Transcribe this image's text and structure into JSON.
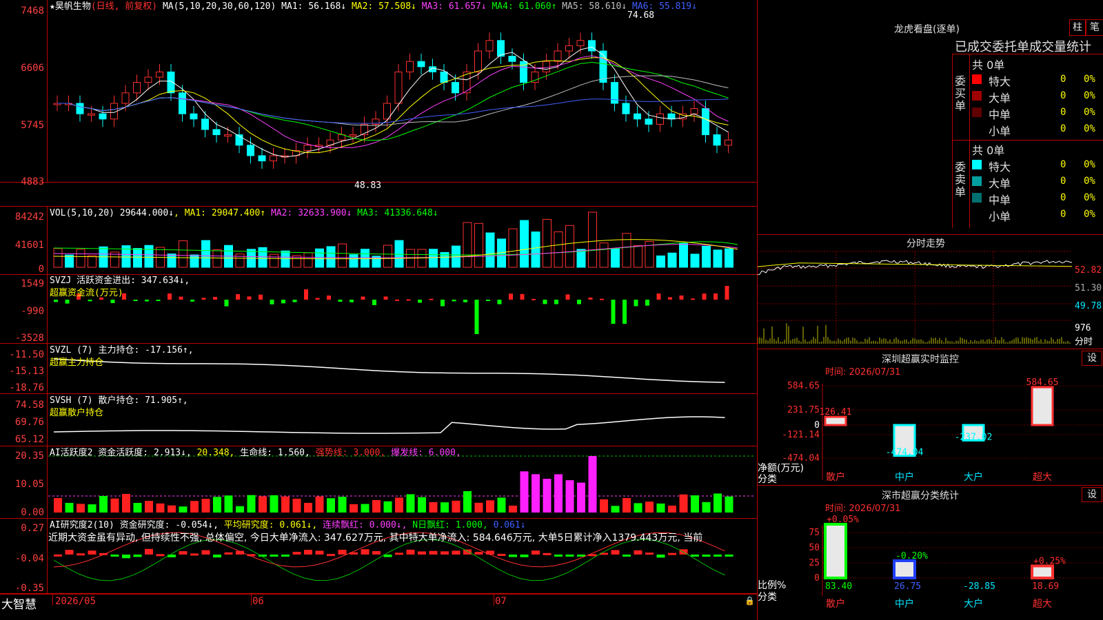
{
  "stock": {
    "name": "★昊帆生物",
    "mode": "(日线, 前复权)",
    "ma_label": "MA(5,10,20,30,60,120)",
    "ma": [
      {
        "label": "MA1:",
        "value": "56.168↓",
        "color": "#ffffff"
      },
      {
        "label": "MA2:",
        "value": "57.508↓",
        "color": "#ffff00"
      },
      {
        "label": "MA3:",
        "value": "61.657↓",
        "color": "#ff40ff"
      },
      {
        "label": "MA4:",
        "value": "61.060↑",
        "color": "#00ff00"
      },
      {
        "label": "MA5:",
        "value": "58.610↓",
        "color": "#c0c0c0"
      },
      {
        "label": "MA6:",
        "value": "55.819↓",
        "color": "#4060ff"
      }
    ],
    "yaxis": [
      "7468",
      "6606",
      "5745",
      "4883"
    ],
    "high_mark": "74.68",
    "low_mark": "48.83"
  },
  "vol": {
    "label": "VOL(5,10,20)",
    "value": "29644.000↓",
    "ma": [
      {
        "label": "MA1:",
        "value": "29047.400↑",
        "color": "#ffff00"
      },
      {
        "label": "MA2:",
        "value": "32633.900↓",
        "color": "#ff40ff"
      },
      {
        "label": "MA3:",
        "value": "41336.648↓",
        "color": "#00ff00"
      }
    ],
    "yaxis": [
      "84242",
      "41601",
      "0"
    ]
  },
  "svzj": {
    "label": "SVZJ  活跃资金进出:",
    "value": "347.634↓,",
    "sub": "超赢资金流(万元)",
    "yaxis": [
      "1549",
      "-990",
      "-3528"
    ]
  },
  "svzl": {
    "label": "SVZL (7) 主力持仓:",
    "value": "-17.156↑,",
    "sub": "超赢主力持仓",
    "yaxis": [
      "-11.50",
      "-15.13",
      "-18.76"
    ]
  },
  "svsh": {
    "label": "SVSH (7) 散户持仓:",
    "value": "71.905↑,",
    "sub": "超赢散户持仓",
    "yaxis": [
      "74.58",
      "69.76",
      "65.12"
    ]
  },
  "ai1": {
    "label": "AI活跃度2 资金活跃度:",
    "v1": "2.913↓,",
    "v2": "20.348,",
    "life": "生命线: 1.560,",
    "strong": "强势线: 3.000,",
    "burst": "爆发线: 6.000,",
    "yaxis": [
      "20.35",
      "10.05",
      "0.00"
    ]
  },
  "ai2": {
    "label": "AI研究度2(10) 资金研究度:",
    "v1": "-0.054↓,",
    "avg": "平均研究度: 0.061↓,",
    "cont": "连续飘红: 0.000↓,",
    "nday": "N日飘红: 1.000,",
    "last": "0.061↓",
    "note": "近期大资金虽有异动, 但持续性不强, 总体偏空, 今日大单净流入: 347.627万元, 其中特大单净流入: 584.646万元, 大单5日累计净入1379.443万元, 当前",
    "yaxis": [
      "0.27",
      "-0.04",
      "-0.35"
    ]
  },
  "xaxis": {
    "brand": "大智慧",
    "d1": "2026/05",
    "d2": "06",
    "d3": "07"
  },
  "right": {
    "dragon_title": "龙虎看盘(逐单)",
    "btn_bar": "柱",
    "btn_tick": "笔",
    "stat_title": "已成交委托单成交量统计",
    "buy": {
      "side": "委买单",
      "total": "共 0单",
      "rows": [
        {
          "name": "特大",
          "v": "0",
          "p": "0%",
          "color": "#ff0000"
        },
        {
          "name": "大单",
          "v": "0",
          "p": "0%",
          "color": "#a00000"
        },
        {
          "name": "中单",
          "v": "0",
          "p": "0%",
          "color": "#600000"
        },
        {
          "name": "小单",
          "v": "0",
          "p": "0%",
          "color": "#000000"
        }
      ]
    },
    "sell": {
      "side": "委卖单",
      "total": "共 0单",
      "rows": [
        {
          "name": "特大",
          "v": "0",
          "p": "0%",
          "color": "#00ffff"
        },
        {
          "name": "大单",
          "v": "0",
          "p": "0%",
          "color": "#00a0a0"
        },
        {
          "name": "中单",
          "v": "0",
          "p": "0%",
          "color": "#007070"
        },
        {
          "name": "小单",
          "v": "0",
          "p": "0%",
          "color": "#000000"
        }
      ]
    },
    "intraday_title": "分时走势",
    "intraday_axis": [
      "52.82",
      "51.30",
      "49.78",
      "976",
      "分时"
    ],
    "sz_monitor_title": "深圳超赢实时监控",
    "settings": "设",
    "time_label": "时间: 2026/07/31",
    "monitor_axis": [
      "584.65",
      "231.75",
      "0",
      "-121.14",
      "-474.04"
    ],
    "monitor_vals": [
      "126.41",
      "-474.04",
      "-237.02",
      "584.65"
    ],
    "monitor_unit": "净额(万元)",
    "cat_label": "分类",
    "cats": [
      "散户",
      "中户",
      "大户",
      "超大"
    ],
    "sz_class_title": "深市超赢分类统计",
    "class_axis": [
      "75",
      "50",
      "25",
      "0"
    ],
    "class_top": [
      "+0.05%",
      "-0.20%",
      "",
      "+0.25%"
    ],
    "class_vals": [
      "83.40",
      "26.75",
      "-28.85",
      "18.69"
    ],
    "ratio_label": "比例%"
  }
}
